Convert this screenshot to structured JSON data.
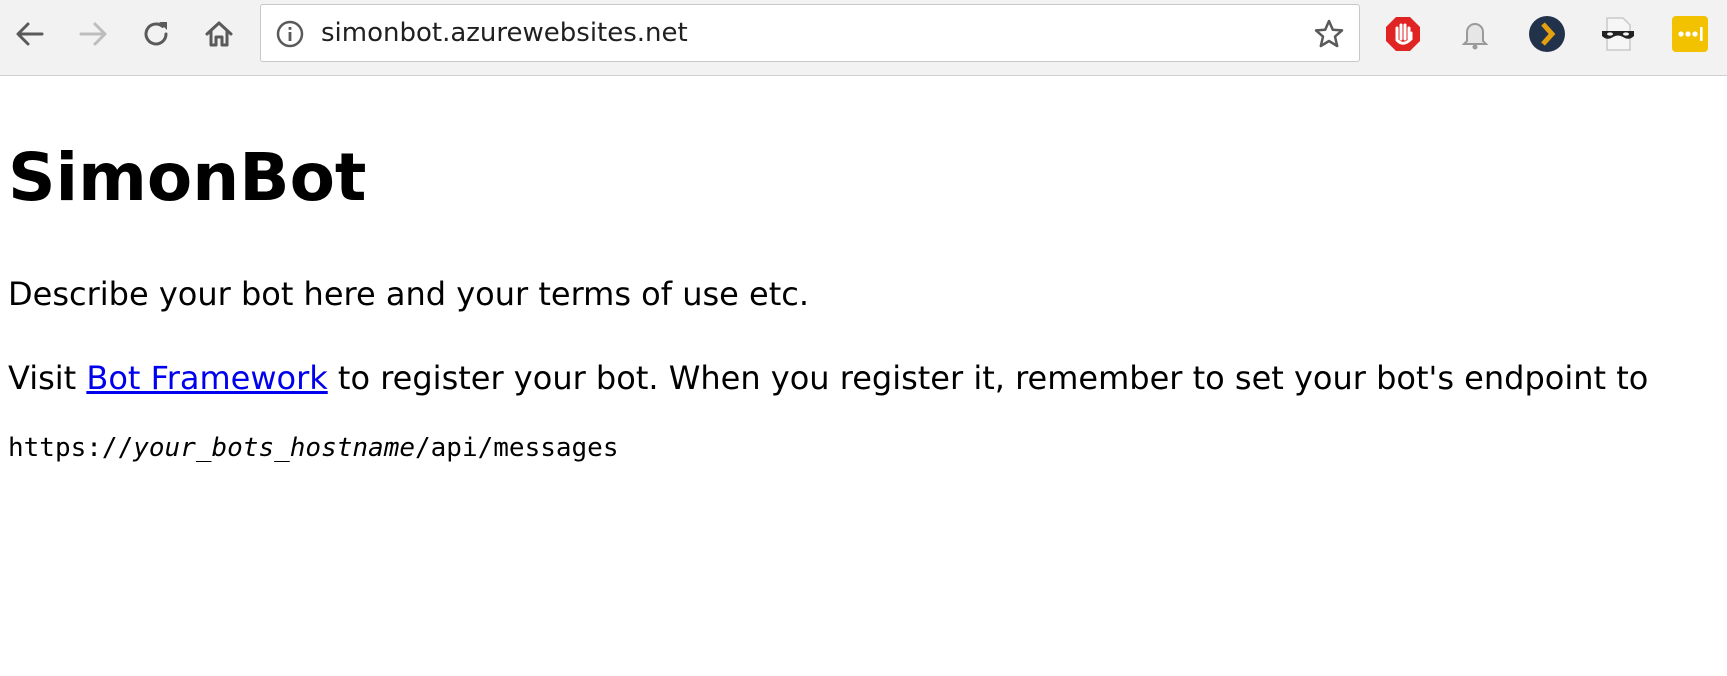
{
  "browser": {
    "url": "simonbot.azurewebsites.net",
    "nav_icons": [
      "back-arrow-icon",
      "forward-arrow-icon",
      "reload-icon",
      "home-icon"
    ],
    "omnibox_icons": [
      "info-icon",
      "bookmark-star-icon"
    ],
    "extensions": [
      {
        "name": "adblock-stop-hand-icon",
        "color": "#e02424"
      },
      {
        "name": "notification-bell-icon",
        "color": "#9a9a9a"
      },
      {
        "name": "plex-chevron-icon",
        "color": "#e5a00d"
      },
      {
        "name": "incognito-mask-icon",
        "color": "#222222"
      },
      {
        "name": "lastpass-icon",
        "color": "#f2c200"
      }
    ]
  },
  "page": {
    "title": "SimonBot",
    "description": "Describe your bot here and your terms of use etc.",
    "visit_prefix": "Visit ",
    "link_text": "Bot Framework",
    "visit_suffix": " to register your bot. When you register it, remember to set your bot's endpoint to",
    "endpoint": {
      "prefix": "https://",
      "hostname": "your_bots_hostname",
      "suffix": "/api/messages"
    }
  },
  "colors": {
    "link": "#0000ee",
    "toolbar_bg": "#f2f2f2"
  }
}
